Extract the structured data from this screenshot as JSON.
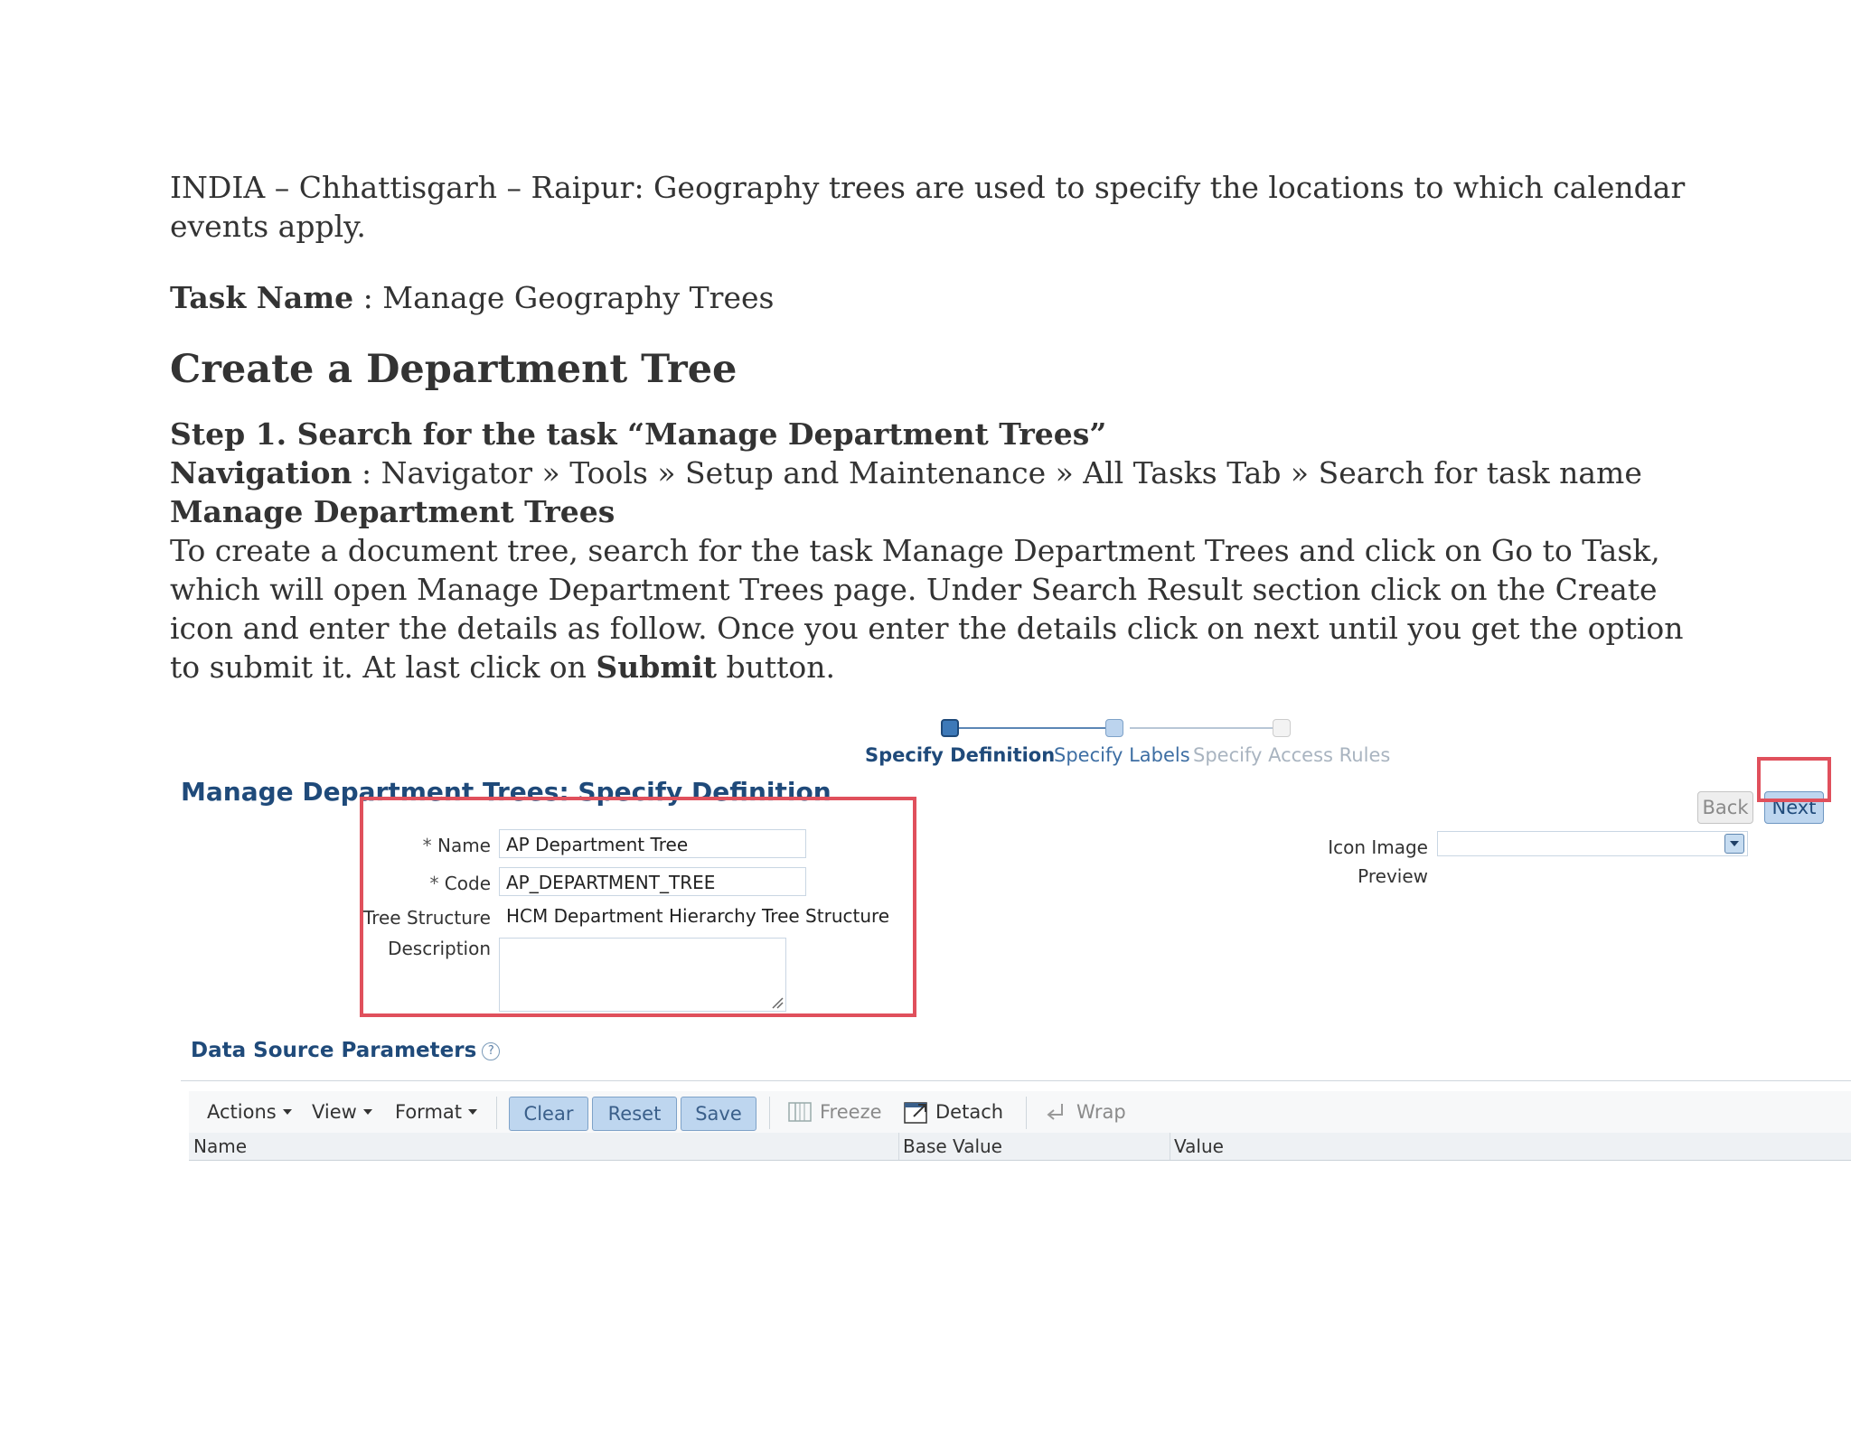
{
  "doc": {
    "intro": "INDIA – Chhattisgarh – Raipur: Geography trees are used to specify the locations to which calendar events apply.",
    "task_label": "Task Name",
    "task_sep": " : ",
    "task_value": "Manage Geography Trees",
    "heading": "Create a Department Tree",
    "step1": "Step 1. Search for the task “Manage Department Trees”",
    "nav_label": "Navigation",
    "nav_text": " : Navigator » Tools » Setup and Maintenance » All Tasks Tab » Search for task name ",
    "nav_bold": "Manage Department Trees",
    "para": "To create a document tree, search for the task Manage Department Trees and click on Go to Task, which will open Manage Department Trees page. Under Search Result section click on the Create icon and enter the details as follow. Once you enter the details click on next until you get the option to submit it. At last click on ",
    "para_bold": "Submit",
    "para_end": " button."
  },
  "train": {
    "steps": [
      "Specify Definition",
      "Specify Labels",
      "Specify Access Rules"
    ]
  },
  "page": {
    "title": "Manage Department Trees: Specify Definition",
    "back": "Back",
    "next": "Next"
  },
  "form": {
    "name_label": "Name",
    "name_value": "AP Department Tree",
    "code_label": "Code",
    "code_value": "AP_DEPARTMENT_TREE",
    "tree_label": "Tree Structure",
    "tree_value": "HCM Department Hierarchy Tree Structure",
    "desc_label": "Description",
    "icon_label": "Icon Image",
    "preview_label": "Preview",
    "required_mark": "*"
  },
  "dsp": {
    "title": "Data Source Parameters",
    "help": "?",
    "menus": [
      "Actions",
      "View",
      "Format"
    ],
    "buttons": [
      "Clear",
      "Reset",
      "Save"
    ],
    "tools": [
      "Freeze",
      "Detach",
      "Wrap"
    ],
    "columns": [
      "Name",
      "Base Value",
      "Value"
    ]
  },
  "colors": {
    "accent": "#1f4a7a",
    "highlight": "#e0505c",
    "button_bg": "#bed6ef"
  }
}
